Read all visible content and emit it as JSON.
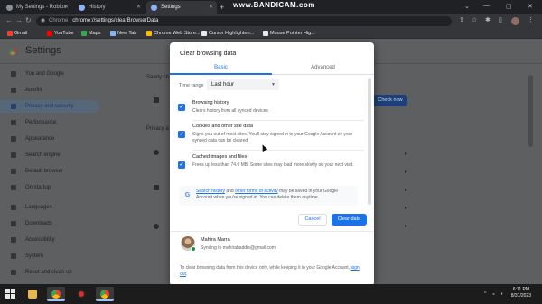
{
  "browser": {
    "tabs": [
      {
        "label": "My Settings - Roblox",
        "active": false,
        "icon_color": "#8a8f96"
      },
      {
        "label": "History",
        "active": false,
        "icon_color": "#8ab4f8"
      },
      {
        "label": "Settings",
        "active": true,
        "icon_color": "#8ab4f8"
      }
    ],
    "watermark": "www.BANDICAM.com",
    "address": {
      "site": "Chrome",
      "separator": " | ",
      "url": "chrome://settings/clearBrowserData"
    },
    "bookmarks": [
      {
        "label": "Gmail",
        "icon_color": "#ea4335"
      },
      {
        "label": "YouTube",
        "icon_color": "#ff0000"
      },
      {
        "label": "Maps",
        "icon_color": "#34a853"
      },
      {
        "label": "New Tab",
        "icon_color": "#8ab4f8"
      },
      {
        "label": "Chrome Web Store...",
        "icon_color": "#fbbc04"
      },
      {
        "label": "Cursor Highlighten...",
        "icon_color": "#e8eaed"
      },
      {
        "label": "Mouse Pointer Hig...",
        "icon_color": "#e8eaed"
      }
    ]
  },
  "settings": {
    "title": "Settings",
    "sidebar": [
      {
        "label": "You and Google",
        "selected": false
      },
      {
        "label": "Autofill",
        "selected": false
      },
      {
        "label": "Privacy and security",
        "selected": true
      },
      {
        "label": "Performance",
        "selected": false
      },
      {
        "label": "Appearance",
        "selected": false
      },
      {
        "label": "Search engine",
        "selected": false
      },
      {
        "label": "Default browser",
        "selected": false
      },
      {
        "label": "On startup",
        "selected": false
      },
      {
        "label": "Languages",
        "selected": false
      },
      {
        "label": "Downloads",
        "selected": false
      },
      {
        "label": "Accessibility",
        "selected": false
      },
      {
        "label": "System",
        "selected": false
      },
      {
        "label": "Reset and clean up",
        "selected": false
      }
    ],
    "fragments": {
      "safety": "Safety ch",
      "privacy": "Privacy a"
    },
    "check_now": "Check now"
  },
  "dialog": {
    "title": "Clear browsing data",
    "tabs": [
      {
        "label": "Basic",
        "active": true
      },
      {
        "label": "Advanced",
        "active": false
      }
    ],
    "time_range": {
      "label": "Time range",
      "value": "Last hour"
    },
    "options": [
      {
        "title": "Browsing history",
        "desc": "Clears history from all synced devices",
        "checked": true
      },
      {
        "title": "Cookies and other site data",
        "desc": "Signs you out of most sites. You'll stay signed in to your Google Account so your synced data can be cleared.",
        "checked": true
      },
      {
        "title": "Cached images and files",
        "desc": "Frees up less than 74.0 MB. Some sites may load more slowly on your next visit.",
        "checked": true
      }
    ],
    "google_note": {
      "link1": "Search history",
      "mid": " and ",
      "link2": "other forms of activity",
      "rest": " may be saved in your Google Account when you're signed in. You can delete them anytime."
    },
    "cancel_label": "Cancel",
    "clear_label": "Clear data",
    "account": {
      "name": "Mahira Marra",
      "sync": "Syncing to mahirabaddie@gmail.com"
    },
    "footer": {
      "text": "To clear browsing data from this device only, while keeping it in your Google Account, ",
      "link": "sign out",
      "end": "."
    }
  },
  "taskbar": {
    "time": "6:11 PM",
    "date": "8/31/2023",
    "apps": [
      "file-explorer",
      "chrome",
      "bandicam",
      "chrome"
    ]
  }
}
